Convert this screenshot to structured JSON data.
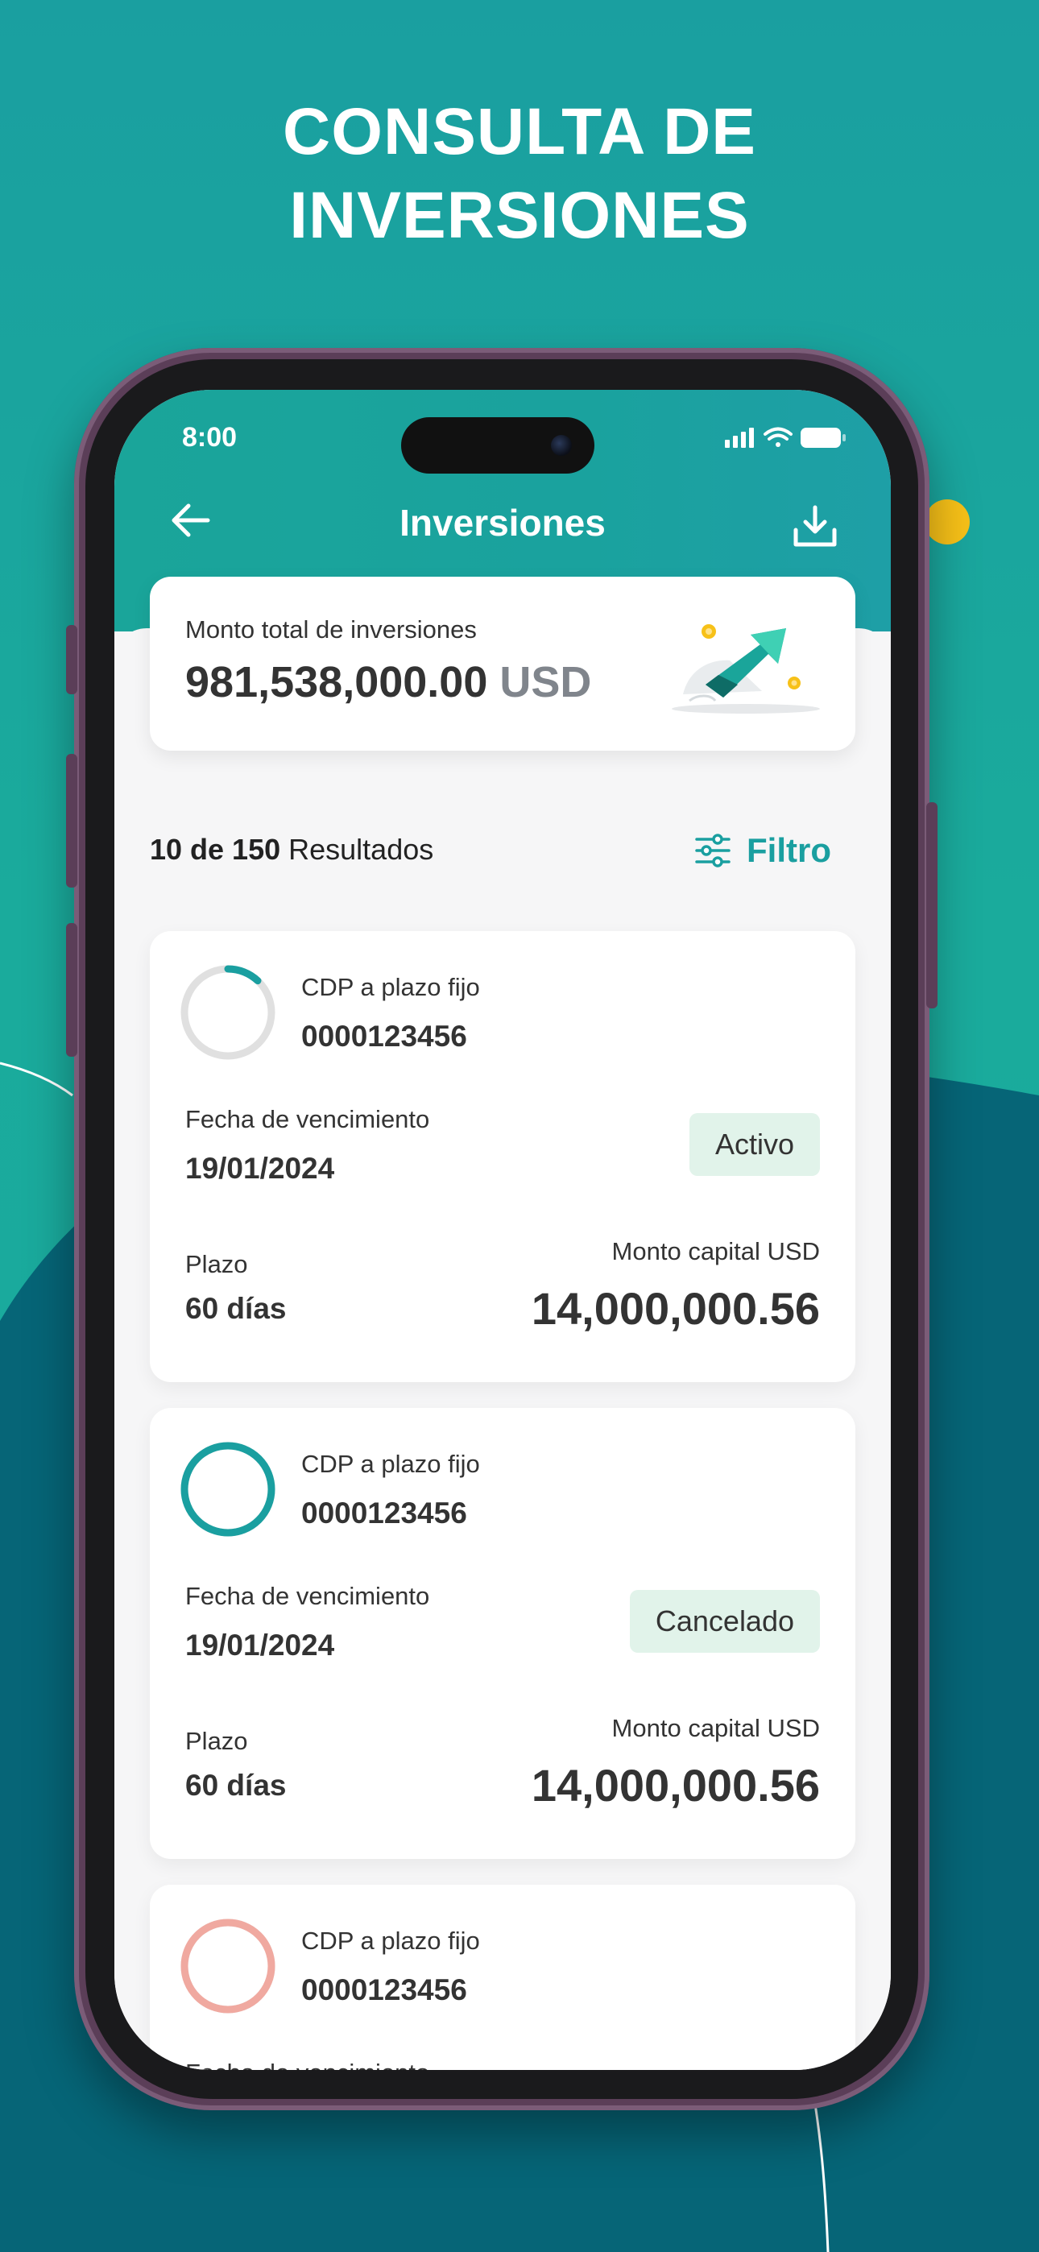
{
  "promo": {
    "headline_line1": "CONSULTA DE",
    "headline_line2": "INVERSIONES"
  },
  "status_bar": {
    "time": "8:00",
    "icons": [
      "signal-icon",
      "wifi-icon",
      "battery-icon"
    ]
  },
  "nav": {
    "title": "Inversiones",
    "back_icon": "arrow-left-icon",
    "download_icon": "download-icon"
  },
  "summary": {
    "label": "Monto total de inversiones",
    "amount": "981,538,000.00",
    "currency": "USD"
  },
  "results": {
    "count_bold": "10 de 150",
    "count_suffix": "Resultados",
    "filter_label": "Filtro"
  },
  "investments": [
    {
      "type": "CDP a plazo fijo",
      "number": "0000123456",
      "due_label": "Fecha de vencimiento",
      "due_date": "19/01/2024",
      "status": "Activo",
      "term_label": "Plazo",
      "term": "60 días",
      "capital_label": "Monto capital USD",
      "capital": "14,000,000.56",
      "progress": 0.12,
      "ring_color": "#1a9fa0"
    },
    {
      "type": "CDP a plazo fijo",
      "number": "0000123456",
      "due_label": "Fecha de vencimiento",
      "due_date": "19/01/2024",
      "status": "Cancelado",
      "term_label": "Plazo",
      "term": "60 días",
      "capital_label": "Monto capital USD",
      "capital": "14,000,000.56",
      "progress": 1.0,
      "ring_color": "#1a9fa0"
    },
    {
      "type": "CDP a plazo fijo",
      "number": "0000123456",
      "due_label": "Fecha de vencimiento",
      "progress": 1.0,
      "ring_color": "#f0a9a0"
    }
  ],
  "colors": {
    "brand_teal": "#1a9fa0",
    "dark_teal": "#06606f",
    "badge_bg": "#e1f3ea",
    "accent_yellow": "#f7c118"
  }
}
